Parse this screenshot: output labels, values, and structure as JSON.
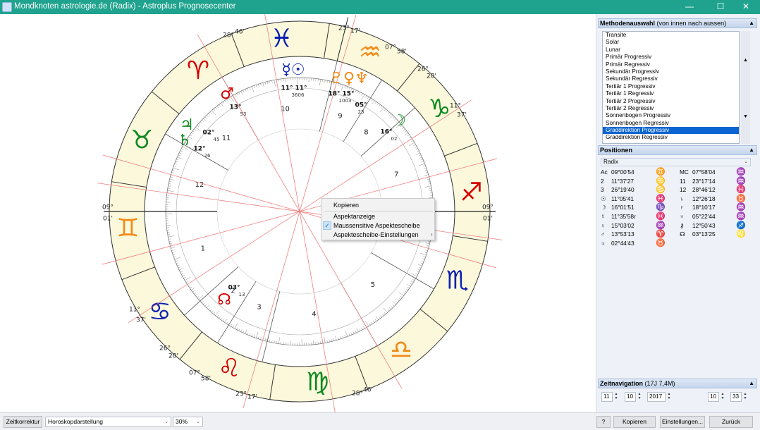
{
  "window": {
    "title": "Mondknoten astrologie.de (Radix) - Astroplus Prognosecenter",
    "minimize": "—",
    "maximize": "☐",
    "close": "✕"
  },
  "chart": {
    "house_numbers": [
      "1",
      "2",
      "3",
      "4",
      "5",
      "6",
      "7",
      "8",
      "9",
      "10",
      "11",
      "12"
    ],
    "degree_labels": {
      "asc_deg": "09°",
      "asc_min": "01'",
      "dsc_deg": "09°",
      "dsc_min": "01'",
      "mc_deg": "23°",
      "mc_min": "17'",
      "ic_deg": "23°",
      "ic_min": "17'",
      "h12_deg": "28°",
      "h12_min": "46'",
      "h8_deg": "07°",
      "h8_min": "58'",
      "h9_deg": "26°",
      "h9_min": "20'",
      "h10_deg": "11°",
      "h10_min": "37'",
      "h3_deg": "26°",
      "h3_min": "20'",
      "h2_deg": "11°",
      "h2_min": "37'",
      "h4_deg": "07°",
      "h4_min": "58'",
      "h6_deg": "28°",
      "h6_min": "46'"
    },
    "planets": [
      {
        "name": "Mars",
        "glyph": "♂",
        "color": "#d40000",
        "deg": "13°",
        "min": "53"
      },
      {
        "name": "Mercury/Sun",
        "glyph": "☿☉",
        "color": "#0b1eb0",
        "deg": "11°",
        "min": "36",
        "deg2": "11°",
        "min2": "06"
      },
      {
        "name": "Pluto/Venus/Neptune",
        "glyph": "♇♀♆",
        "color": "#f28a17",
        "deg": "18°",
        "min": "10",
        "deg2": "15°",
        "min2": "03",
        "deg3": "05°",
        "min3": "23"
      },
      {
        "name": "Moon",
        "glyph": "☽",
        "color": "#0c8a1e",
        "deg": "16°",
        "min": "02"
      },
      {
        "name": "Jupiter",
        "glyph": "♃",
        "color": "#0c8a1e",
        "deg": "02°",
        "min": "45"
      },
      {
        "name": "Saturn",
        "glyph": "♄",
        "color": "#0c8a1e",
        "deg": "12°",
        "min": "26"
      },
      {
        "name": "Node",
        "glyph": "☊",
        "color": "#d40000",
        "deg": "03°",
        "min": "13"
      }
    ],
    "signs": [
      {
        "sym": "♓",
        "color": "#0b1eb0"
      },
      {
        "sym": "♒",
        "color": "#f28a17"
      },
      {
        "sym": "♑",
        "color": "#0c8a1e"
      },
      {
        "sym": "♐",
        "color": "#d40000"
      },
      {
        "sym": "♏",
        "color": "#0b1eb0"
      },
      {
        "sym": "♎",
        "color": "#f28a17"
      },
      {
        "sym": "♍",
        "color": "#0c8a1e"
      },
      {
        "sym": "♌",
        "color": "#d40000"
      },
      {
        "sym": "♋",
        "color": "#0b1eb0"
      },
      {
        "sym": "♊",
        "color": "#f28a17"
      },
      {
        "sym": "♉",
        "color": "#0c8a1e"
      },
      {
        "sym": "♈",
        "color": "#d40000"
      }
    ]
  },
  "context_menu": {
    "items": [
      "Kopieren",
      "Aspektanzeige",
      "Maussensitive Aspektescheibe",
      "Aspektescheibe-Einstellungen"
    ],
    "checked_item": "Maussensitive Aspektescheibe",
    "submenu_arrow": "›",
    "check_mark": "✓"
  },
  "method_panel": {
    "title": "Methodenauswahl",
    "subtitle": "(von innen nach aussen)",
    "items": [
      "Transite",
      "Solar",
      "Lunar",
      "Primär Progressiv",
      "Primär Regressiv",
      "Sekundär Progressiv",
      "Sekundär Regressiv",
      "Tertiär 1 Progressiv",
      "Tertiär 1 Regressiv",
      "Tertiär 2 Progressiv",
      "Tertiär 2 Regressiv",
      "Sonnenbogen Progressiv",
      "Sonnenbogen Regressiv",
      "Graddirektion Progressiv",
      "Graddirektion Regressiv"
    ],
    "selected": "Graddirektion Progressiv",
    "scroll_up": "▲",
    "scroll_down": "▼",
    "collapse": "▲"
  },
  "positions_panel": {
    "title": "Positionen",
    "collapse": "▲",
    "select_value": "Radix",
    "rows": [
      {
        "l_label": "Ac",
        "l_value": "09°00'54",
        "l_sign": "♊",
        "l_color": "#f28a17",
        "r_label": "MC",
        "r_value": "07°58'04",
        "r_sign": "♒",
        "r_color": "#f28a17"
      },
      {
        "l_label": "2",
        "l_value": "11°37'27",
        "l_sign": "♋",
        "l_color": "#0b1eb0",
        "r_label": "11",
        "r_value": "23°17'14",
        "r_sign": "♒",
        "r_color": "#f28a17"
      },
      {
        "l_label": "3",
        "l_value": "26°19'40",
        "l_sign": "♋",
        "l_color": "#0b1eb0",
        "r_label": "12",
        "r_value": "28°46'12",
        "r_sign": "♓",
        "r_color": "#0b1eb0"
      },
      {
        "l_label": "☉",
        "l_value": "11°05'41",
        "l_sign": "♓",
        "l_color": "#0b1eb0",
        "r_label": "♄",
        "r_value": "12°26'18",
        "r_sign": "♉",
        "r_color": "#0c8a1e"
      },
      {
        "l_label": "☽",
        "l_value": "16°01'51",
        "l_sign": "♑",
        "l_color": "#0c8a1e",
        "r_label": "♇",
        "r_value": "18°10'17",
        "r_sign": "♒",
        "r_color": "#f28a17"
      },
      {
        "l_label": "☿",
        "l_value": "11°35'58r",
        "l_sign": "♓",
        "l_color": "#0b1eb0",
        "r_label": "♆",
        "r_value": "05°22'44",
        "r_sign": "♒",
        "r_color": "#f28a17"
      },
      {
        "l_label": "♀",
        "l_value": "15°03'02",
        "l_sign": "♒",
        "l_color": "#f28a17",
        "r_label": "⚷",
        "r_value": "12°50'43",
        "r_sign": "♐",
        "r_color": "#d40000"
      },
      {
        "l_label": "♂",
        "l_value": "13°53'13",
        "l_sign": "♈",
        "l_color": "#d40000",
        "r_label": "☊",
        "r_value": "03°13'25",
        "r_sign": "♌",
        "r_color": "#d40000"
      },
      {
        "l_label": "♃",
        "l_value": "02°44'43",
        "l_sign": "♉",
        "l_color": "#0c8a1e",
        "r_label": "",
        "r_value": "",
        "r_sign": "",
        "r_color": "#000000"
      }
    ]
  },
  "time_nav": {
    "title": "Zeitnavigation",
    "subtitle": "(17J 7,4M)",
    "day": "11",
    "month": "10",
    "year": "2017",
    "hour": "10",
    "minute": "33",
    "spin_up": "▲",
    "spin_down": "▼"
  },
  "statusbar": {
    "zeitkorrektur": "Zeitkorrektur",
    "view_select": "Horoskopdarstellung",
    "zoom": "30%",
    "help": "?",
    "kopieren": "Kopieren",
    "einstellungen": "Einstellungen...",
    "zurueck": "Zurück",
    "dropdown": "⌄"
  }
}
